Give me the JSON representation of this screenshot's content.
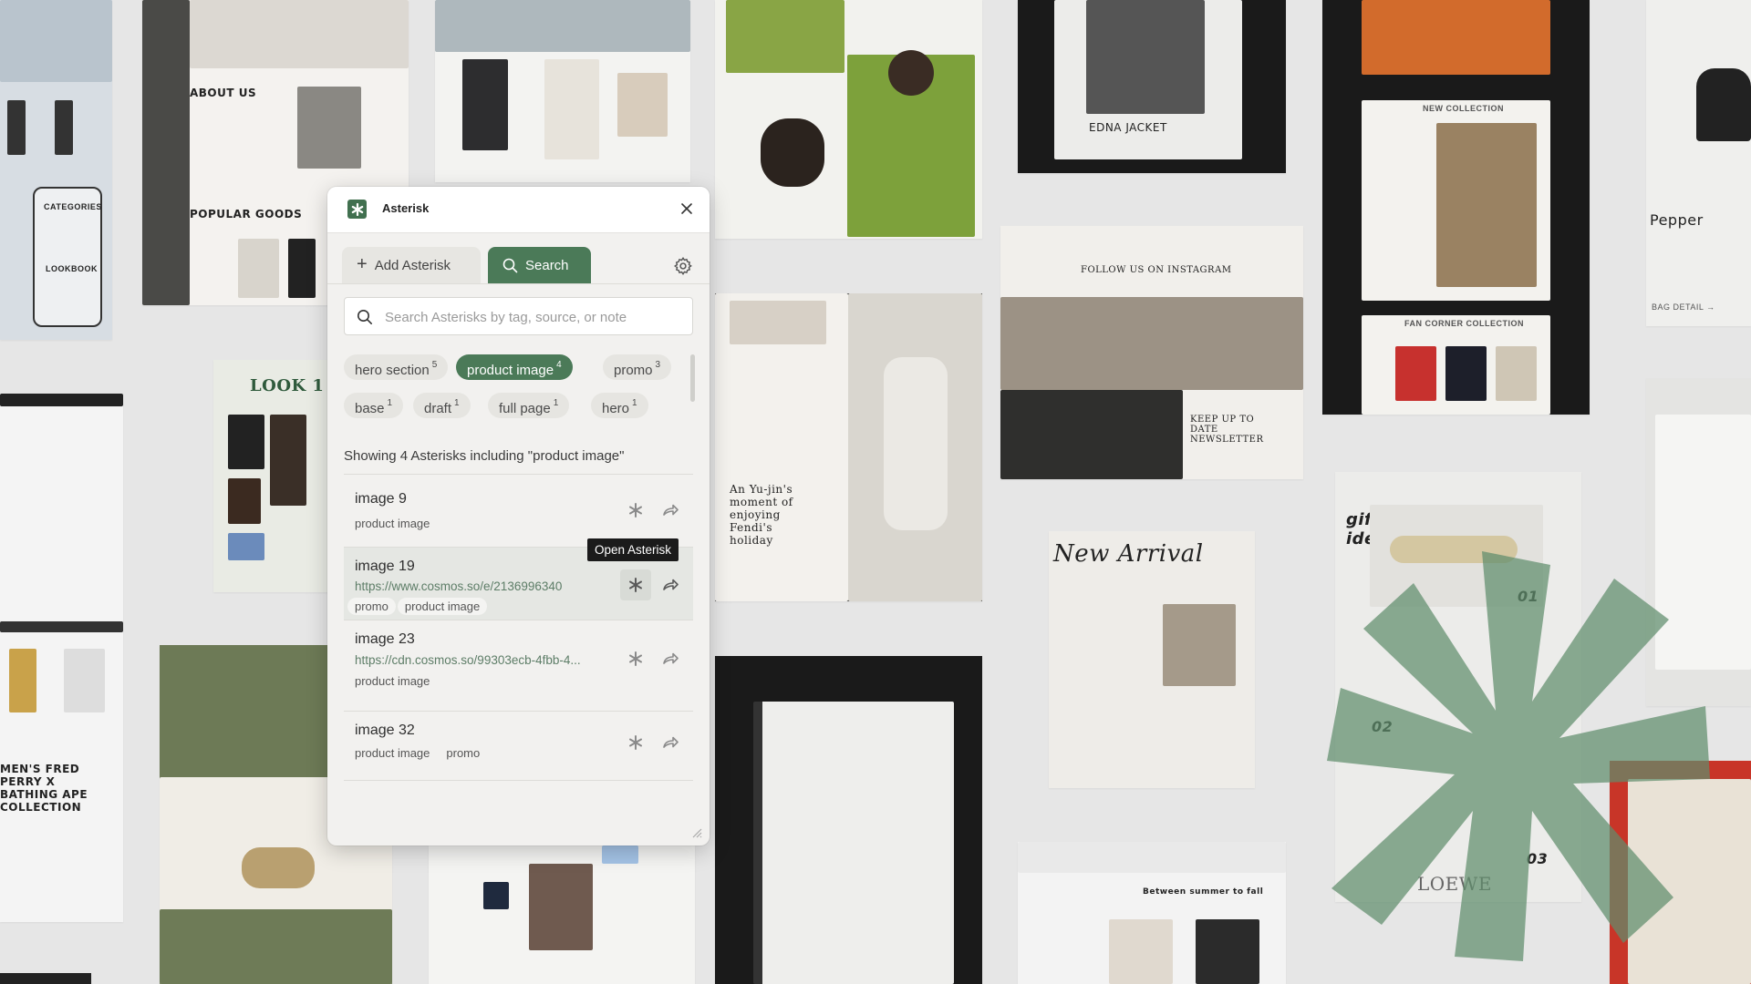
{
  "background": {
    "about_heading": "ABOUT US",
    "popular_heading": "POPULAR GOODS",
    "categories_label": "CATEGORIES",
    "lookbook_label": "LOOKBOOK",
    "look_label": "LOOK 1",
    "edna_label": "EDNA JACKET",
    "instagram_label": "FOLLOW US ON INSTAGRAM",
    "newsletter_label": "KEEP UP TO DATE NEWSLETTER",
    "new_collection_label": "NEW COLLECTION",
    "fan_corner_label": "FAN CORNER COLLECTION",
    "pepper_label": "Pepper",
    "bag_detail_label": "BAG DETAIL →",
    "gift_label": "gift ideas.",
    "new_arrival_label": "New Arrival",
    "loewe_label": "LOEWE",
    "wishlist_label": "Between summer to fall",
    "prada_caption": "An Yu-jin's moment of enjoying Fendi's holiday",
    "bape_label": "MEN'S FRED PERRY X BATHING APE COLLECTION",
    "numbers": [
      "01",
      "02",
      "03"
    ]
  },
  "panel": {
    "app_title": "Asterisk",
    "tabs": {
      "add_label": "Add Asterisk",
      "search_label": "Search"
    },
    "search": {
      "placeholder": "Search Asterisks by tag, source, or note",
      "value": ""
    },
    "tags": [
      {
        "name": "hero section",
        "count": "5"
      },
      {
        "name": "product image",
        "count": "4",
        "active": true
      },
      {
        "name": "promo",
        "count": "3"
      },
      {
        "name": "base",
        "count": "1"
      },
      {
        "name": "draft",
        "count": "1"
      },
      {
        "name": "full page",
        "count": "1"
      },
      {
        "name": "hero",
        "count": "1"
      }
    ],
    "showing_text": "Showing 4 Asterisks including \"product image\"",
    "results": [
      {
        "title": "image 9",
        "url": "",
        "tags": [
          "product image"
        ]
      },
      {
        "title": "image 19",
        "url": "https://www.cosmos.so/e/2136996340",
        "tags": [
          "promo",
          "product image"
        ]
      },
      {
        "title": "image 23",
        "url": "https://cdn.cosmos.so/99303ecb-4fbb-4...",
        "tags": [
          "product image"
        ]
      },
      {
        "title": "image 32",
        "url": "",
        "tags": [
          "product image",
          "promo"
        ]
      }
    ],
    "tooltip": "Open Asterisk"
  },
  "colors": {
    "accent": "#4b7a58",
    "background": "#e6e6e6",
    "panel": "#f2f1ef"
  }
}
